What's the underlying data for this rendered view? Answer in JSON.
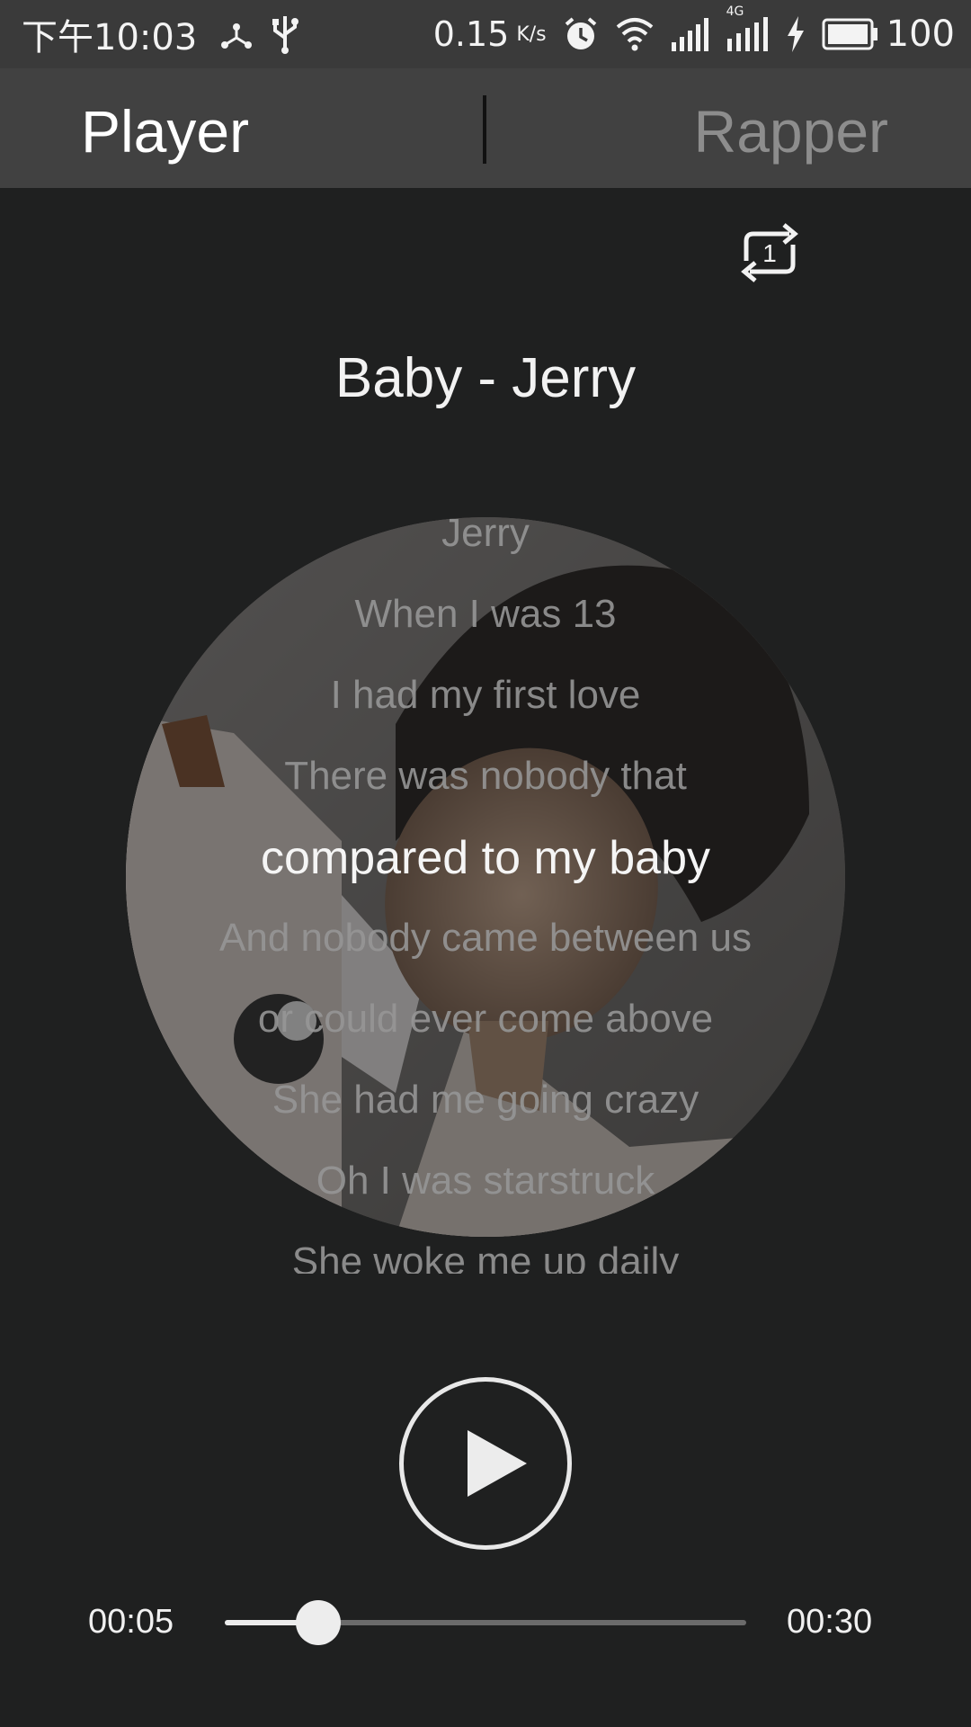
{
  "status_bar": {
    "time": "下午10:03",
    "speed": "0.15",
    "speed_unit": "K/s",
    "network_label": "4G",
    "battery": "100",
    "icons": [
      "usb-tether-icon",
      "usb-icon",
      "alarm-icon",
      "wifi-icon",
      "signal-icon",
      "signal-4g-icon",
      "charging-icon",
      "battery-icon"
    ]
  },
  "tabs": {
    "player": "Player",
    "rapper": "Rapper"
  },
  "repeat": {
    "icon": "repeat-one-icon",
    "label": "1"
  },
  "song": {
    "title": "Baby - Jerry"
  },
  "lyrics": {
    "lines": [
      "Jerry",
      "When I was 13",
      "I had my first love",
      "There was nobody that",
      "compared to my baby",
      "And nobody came between us",
      "or could ever come above",
      "She had me going crazy",
      "Oh I was starstruck",
      "She woke me up daily"
    ],
    "current_index": 4
  },
  "player": {
    "play_icon": "play-icon",
    "elapsed": "00:05",
    "total": "00:30",
    "progress": 0.18
  },
  "colors": {
    "background": "#1f2020",
    "tab_bar": "#414141",
    "status_bar": "#3a3a3a",
    "active_text": "#ffffff",
    "inactive_text": "#8d8d8d"
  }
}
